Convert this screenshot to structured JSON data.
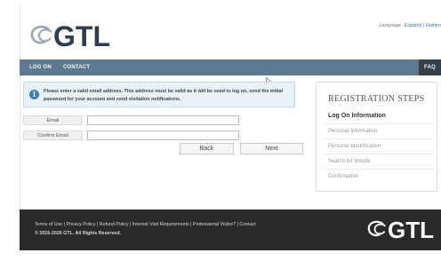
{
  "header": {
    "logo_text": "GTL",
    "language_label": "Language",
    "language_links": "Español | Haitien"
  },
  "nav": {
    "logon": "LOG ON",
    "contact": "CONTACT",
    "faq": "FAQ"
  },
  "info_message": "Please enter a valid email address. This address must be valid as it will be used to log on, send the initial password for your account and send visitation notifications.",
  "form": {
    "email_label": "Email",
    "email_value": "",
    "confirm_label": "Confirm Email",
    "confirm_value": "",
    "back_label": "Back",
    "next_label": "Next"
  },
  "steps": {
    "title": "REGISTRATION STEPS",
    "items": [
      "Log On Information",
      "Personal Information",
      "Personal Identification",
      "Search for Inmate",
      "Confirmation"
    ]
  },
  "footer": {
    "links": "Terms of Use | Privacy Policy | Refund Policy | Internet Visit Requirements | Professional Visitor? | Contact",
    "copyright": "© 2016-2020 GTL. All Rights Reserved.",
    "logo_text": "GTL"
  },
  "colors": {
    "nav_bg": "#5d7a91",
    "faq_bg": "#33414d",
    "info_bg": "#e7f1f7",
    "footer_bg": "#2a2a2a",
    "link": "#3a78b8"
  },
  "icons": [
    "gtl-logo-icon",
    "info-icon",
    "mouse-cursor-icon"
  ]
}
